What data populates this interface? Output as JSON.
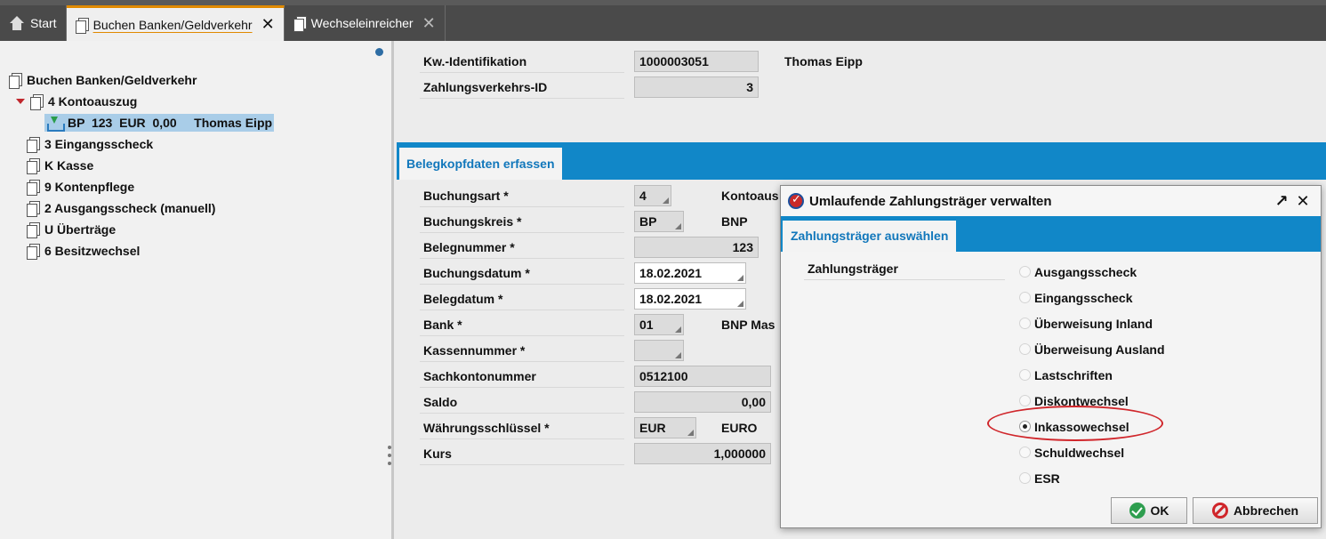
{
  "tabs": [
    {
      "label": "Start"
    },
    {
      "label": "Buchen Banken/Geldverkehr"
    },
    {
      "label": "Wechseleinreicher"
    }
  ],
  "tree": {
    "root": "Buchen Banken/Geldverkehr",
    "items": [
      {
        "label": "4 Kontoauszug"
      },
      {
        "label": "BP  123  EUR  0,00     Thomas Eipp"
      },
      {
        "label": "3 Eingangsscheck"
      },
      {
        "label": "K Kasse"
      },
      {
        "label": "9 Kontenpflege"
      },
      {
        "label": "2 Ausgangsscheck (manuell)"
      },
      {
        "label": "U Überträge"
      },
      {
        "label": "6 Besitzwechsel"
      }
    ]
  },
  "header": {
    "kw_label": "Kw.-Identifikation",
    "kw_value": "1000003051",
    "kw_name": "Thomas Eipp",
    "zv_label": "Zahlungsverkehrs-ID",
    "zv_value": "3"
  },
  "section_tab": "Belegkopfdaten erfassen",
  "form": [
    {
      "label": "Buchungsart *",
      "value": "4",
      "side": "Kontoaus"
    },
    {
      "label": "Buchungskreis *",
      "value": "BP",
      "side": "BNP"
    },
    {
      "label": "Belegnummer *",
      "value": "123",
      "side": ""
    },
    {
      "label": "Buchungsdatum *",
      "value": "18.02.2021",
      "side": ""
    },
    {
      "label": "Belegdatum *",
      "value": "18.02.2021",
      "side": ""
    },
    {
      "label": "Bank *",
      "value": "01",
      "side": "BNP Mas"
    },
    {
      "label": "Kassennummer *",
      "value": "",
      "side": ""
    },
    {
      "label": "Sachkontonummer",
      "value": "0512100",
      "side": ""
    },
    {
      "label": "Saldo",
      "value": "0,00",
      "side": ""
    },
    {
      "label": "Währungsschlüssel *",
      "value": "EUR",
      "side": "EURO"
    },
    {
      "label": "Kurs",
      "value": "1,000000",
      "side": ""
    }
  ],
  "dialog": {
    "title": "Umlaufende Zahlungsträger verwalten",
    "tab": "Zahlungsträger auswählen",
    "field_label": "Zahlungsträger",
    "options": [
      "Ausgangsscheck",
      "Eingangsscheck",
      "Überweisung Inland",
      "Überweisung Ausland",
      "Lastschriften",
      "Diskontwechsel",
      "Inkassowechsel",
      "Schuldwechsel",
      "ESR"
    ],
    "selected": "Inkassowechsel",
    "ok_label": "OK",
    "cancel_label": "Abbrechen",
    "restore_glyph": "↗",
    "close_glyph": "✕"
  },
  "colors": {
    "accent_blue": "#1187c8",
    "tab_active_underline": "#e08a00",
    "highlight_circle": "#d0262b"
  }
}
